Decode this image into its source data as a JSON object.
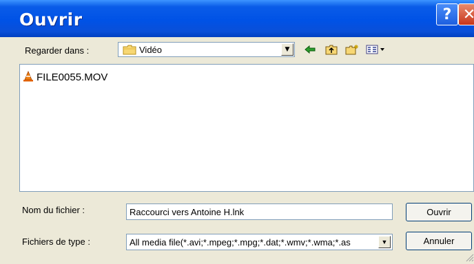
{
  "window": {
    "title": "Ouvrir",
    "help_glyph": "?",
    "close_glyph": "✕"
  },
  "lookin": {
    "label": "Regarder dans :",
    "value": "Vidéo",
    "icon": "folder-icon"
  },
  "toolbar": {
    "back_icon": "back-arrow-icon",
    "up_icon": "up-folder-icon",
    "new_icon": "new-folder-icon",
    "view_icon": "view-menu-icon"
  },
  "files": [
    {
      "name": "FILE0055.MOV",
      "icon": "vlc-cone-icon"
    }
  ],
  "filename": {
    "label": "Nom du fichier :",
    "value": "Raccourci vers Antoine H.lnk"
  },
  "filetype": {
    "label": "Fichiers de type :",
    "value": "All media file(*.avi;*.mpeg;*.mpg;*.dat;*.wmv;*.wma;*.as"
  },
  "buttons": {
    "open": "Ouvrir",
    "cancel": "Annuler"
  },
  "colors": {
    "titlebar": "#0052E6",
    "dialog_bg": "#ECE9D8",
    "field_border": "#7F9DB9"
  }
}
